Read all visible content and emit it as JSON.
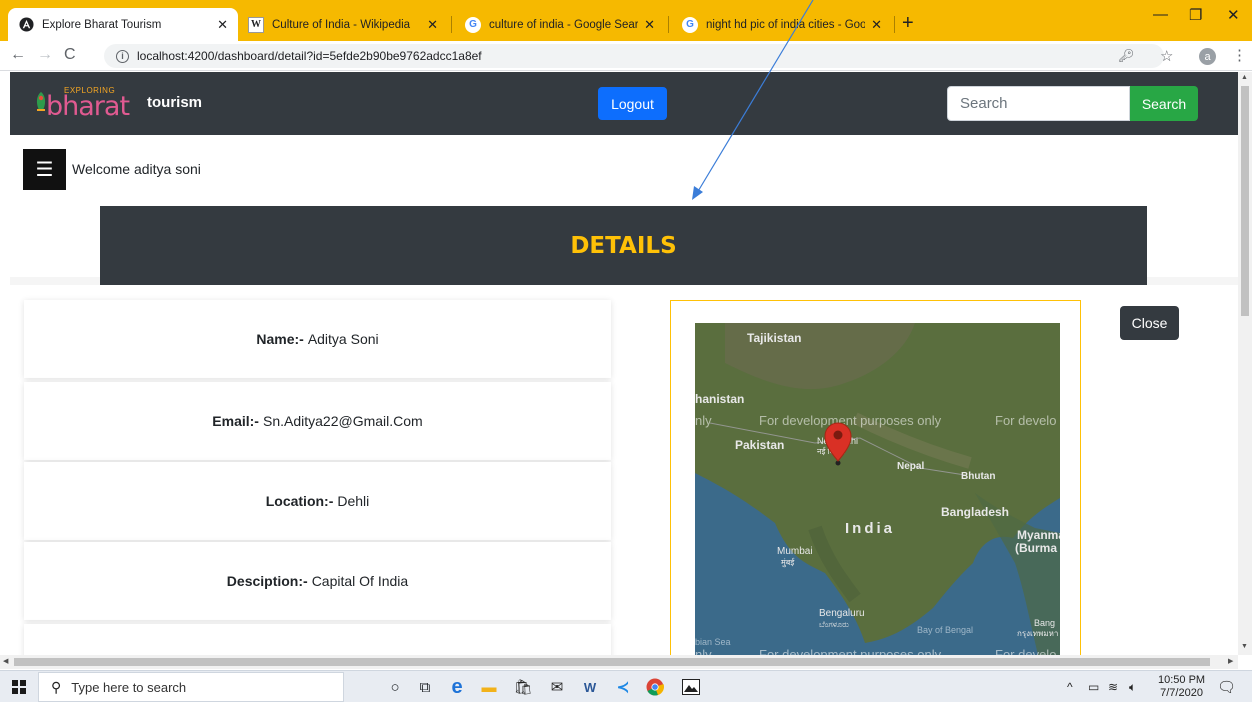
{
  "browser": {
    "tabs": [
      {
        "title": "Explore Bharat Tourism",
        "icon": "angular-icon",
        "active": true
      },
      {
        "title": "Culture of India - Wikipedia",
        "icon": "wikipedia-icon",
        "active": false
      },
      {
        "title": "culture of india - Google Search",
        "icon": "google-icon",
        "active": false
      },
      {
        "title": "night hd pic of india cities - Goog",
        "icon": "google-icon",
        "active": false
      }
    ],
    "url": "localhost:4200/dashboard/detail?id=5efde2b90be9762adcc1a8ef",
    "profile_initial": "a"
  },
  "navbar": {
    "logo_small": "EXPLORING",
    "logo_big": "bharat",
    "brand": "tourism",
    "logout_label": "Logout",
    "search_placeholder": "Search",
    "search_button": "Search"
  },
  "welcome_text": "Welcome aditya soni",
  "details_title": "DETAILS",
  "details": [
    {
      "label": "Name:-",
      "value": "Aditya Soni"
    },
    {
      "label": "Email:-",
      "value": "Sn.Aditya22@Gmail.Com"
    },
    {
      "label": "Location:-",
      "value": "Dehli"
    },
    {
      "label": "Desciption:-",
      "value": "Capital Of India"
    }
  ],
  "map": {
    "labels": {
      "tajikistan": "Tajikistan",
      "afghanistan": "hanistan",
      "pakistan": "Pakistan",
      "new_delhi": "New Delhi",
      "new_delhi_local": "नई दिल्ली",
      "nepal": "Nepal",
      "bhutan": "Bhutan",
      "bangladesh": "Bangladesh",
      "india": "India",
      "myanmar": "Myanma",
      "myanmar2": "(Burma",
      "mumbai": "Mumbai",
      "mumbai_local": "मुंबई",
      "bengaluru": "Bengaluru",
      "bengaluru_local": "ಬೆಂಗಳೂರು",
      "bay_of_bengal": "Bay of Bengal",
      "arabian_sea": "bian Sea",
      "bangkok": "Bang",
      "bangkok_local": "กรุงเทพมหา"
    },
    "watermark_left": "nly",
    "watermark_center": "For development purposes only",
    "watermark_right": "For develo",
    "colors": {
      "land": "#5a6e3e",
      "water": "#3b6a8a",
      "marker": "#d93025"
    }
  },
  "close_label": "Close",
  "taskbar": {
    "search_placeholder": "Type here to search",
    "time": "10:50 PM",
    "date": "7/7/2020"
  },
  "colors": {
    "chrome_accent": "#f6b900",
    "navbar_bg": "#343a40",
    "title_yellow": "#ffc107",
    "logout_blue": "#0d6efd",
    "search_green": "#28a745"
  }
}
